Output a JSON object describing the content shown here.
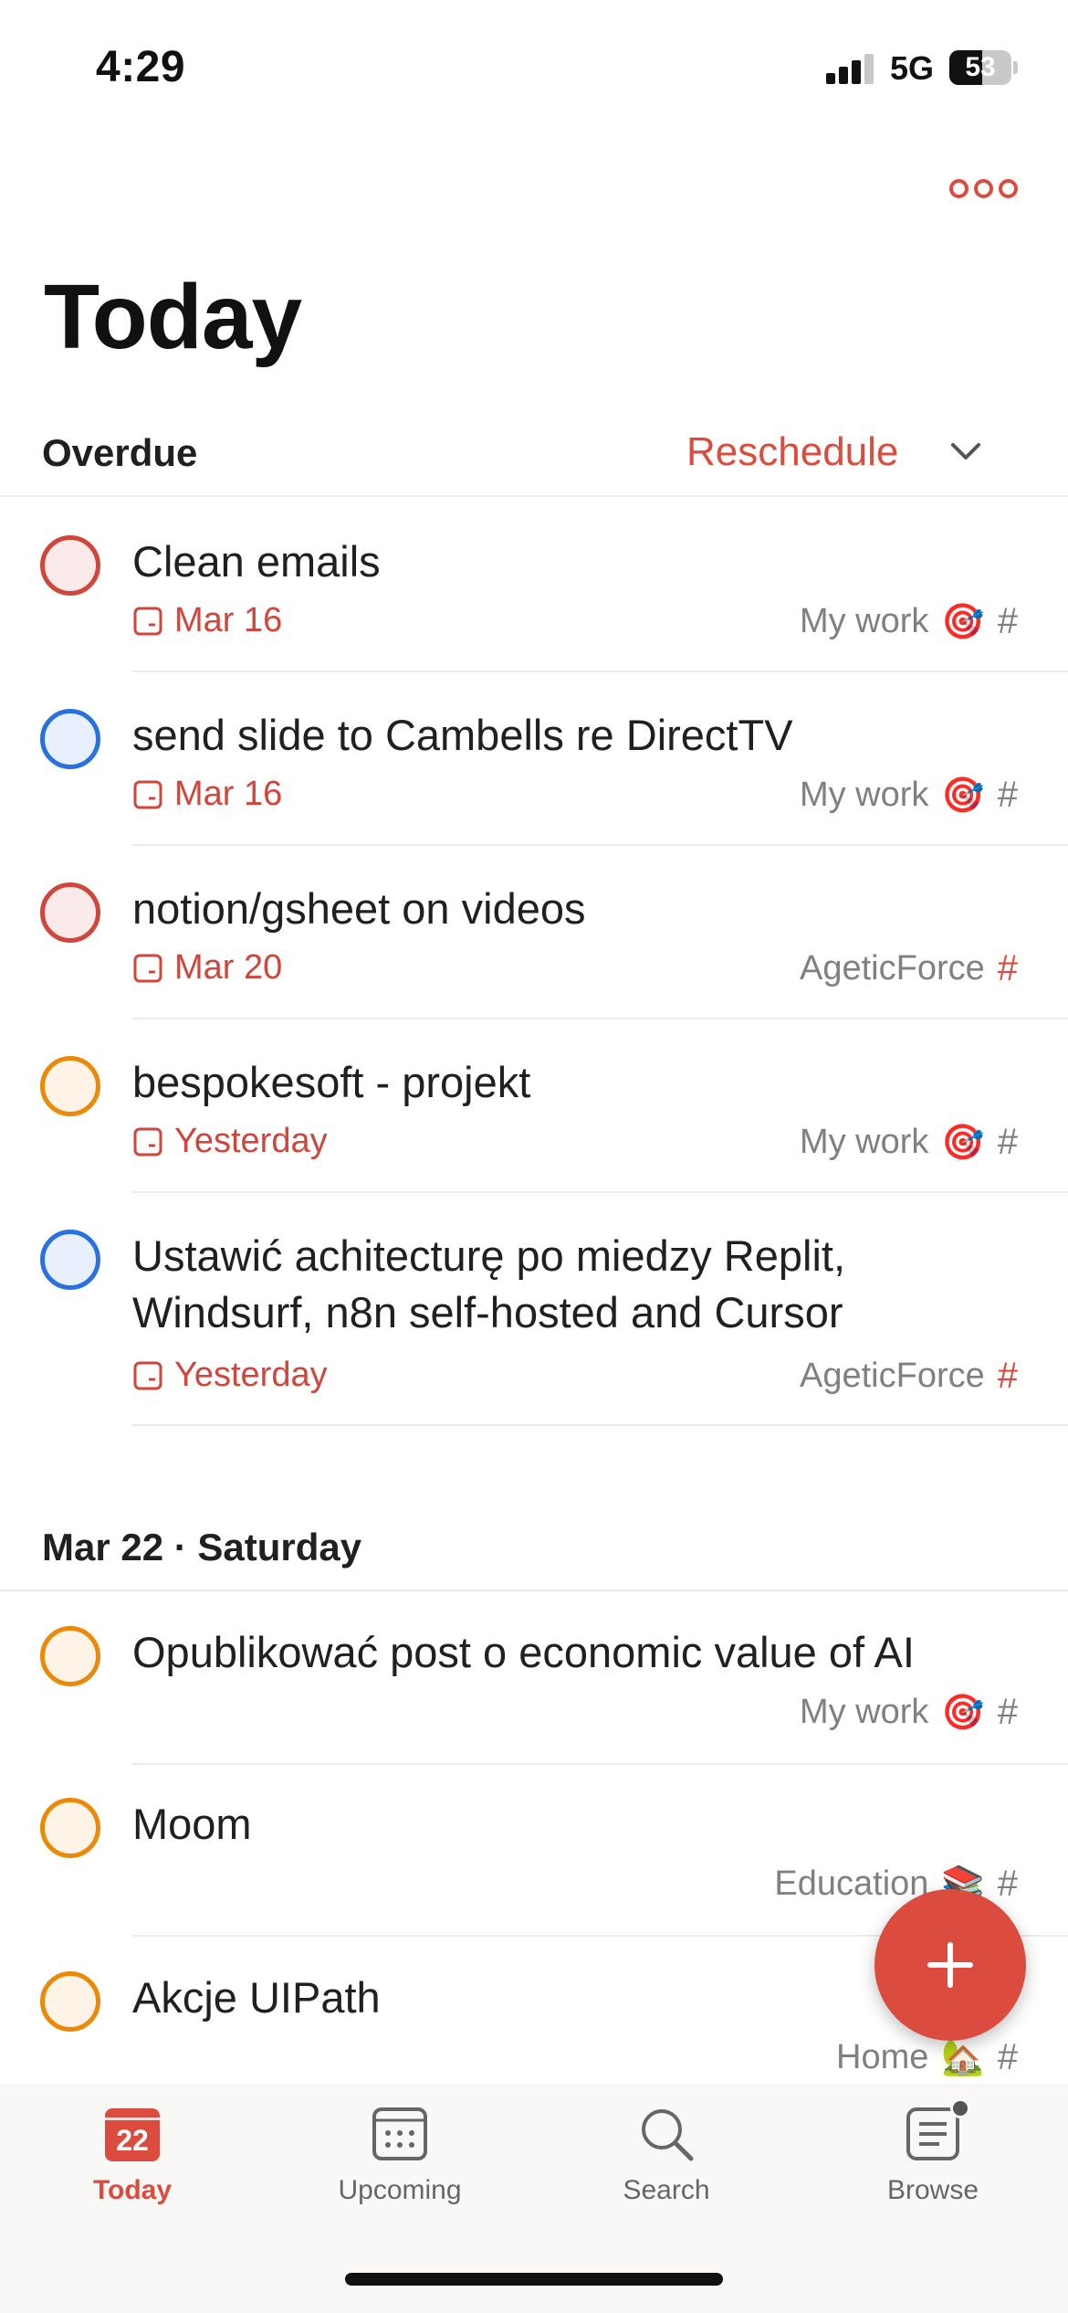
{
  "status_bar": {
    "time": "4:29",
    "network": "5G",
    "battery": "53",
    "battery_level": 0.53
  },
  "header": {
    "title": "Today"
  },
  "overdue": {
    "title": "Overdue",
    "reschedule_label": "Reschedule",
    "tasks": [
      {
        "title": "Clean emails",
        "date": "Mar 16",
        "project": "My work",
        "project_emoji": "🎯",
        "priority": "p1"
      },
      {
        "title": "send slide to Cambells re DirectTV",
        "date": "Mar 16",
        "project": "My work",
        "project_emoji": "🎯",
        "priority": "p2"
      },
      {
        "title": "notion/gsheet on videos",
        "date": "Mar 20",
        "project": "AgeticForce",
        "project_emoji": "",
        "priority": "p1"
      },
      {
        "title": "bespokesoft - projekt",
        "date": "Yesterday",
        "project": "My work",
        "project_emoji": "🎯",
        "priority": "p3"
      },
      {
        "title": "Ustawić achitecturę po miedzy Replit, Windsurf, n8n self-hosted and Cursor",
        "date": "Yesterday",
        "project": "AgeticForce",
        "project_emoji": "",
        "priority": "p2"
      }
    ]
  },
  "day_section": {
    "title": "Mar 22 · Saturday",
    "tasks": [
      {
        "title": "Opublikować post o economic value of AI",
        "project": "My work",
        "project_emoji": "🎯",
        "priority": "p3"
      },
      {
        "title": "Moom",
        "project": "Education",
        "project_emoji": "📚",
        "priority": "p3"
      },
      {
        "title": "Akcje UIPath",
        "project": "Home",
        "project_emoji": "🏡",
        "priority": "p3"
      }
    ]
  },
  "tab_bar": {
    "today_badge": "22",
    "tabs": [
      {
        "label": "Today",
        "icon": "calendar-today-icon",
        "active": true
      },
      {
        "label": "Upcoming",
        "icon": "calendar-grid-icon",
        "active": false
      },
      {
        "label": "Search",
        "icon": "search-icon",
        "active": false
      },
      {
        "label": "Browse",
        "icon": "browse-list-icon",
        "active": false
      }
    ]
  },
  "colors": {
    "accent": "#dc4c3e",
    "p1": "#d1453b",
    "p2": "#2a71e0",
    "p3": "#eb8909",
    "muted": "#808080"
  }
}
